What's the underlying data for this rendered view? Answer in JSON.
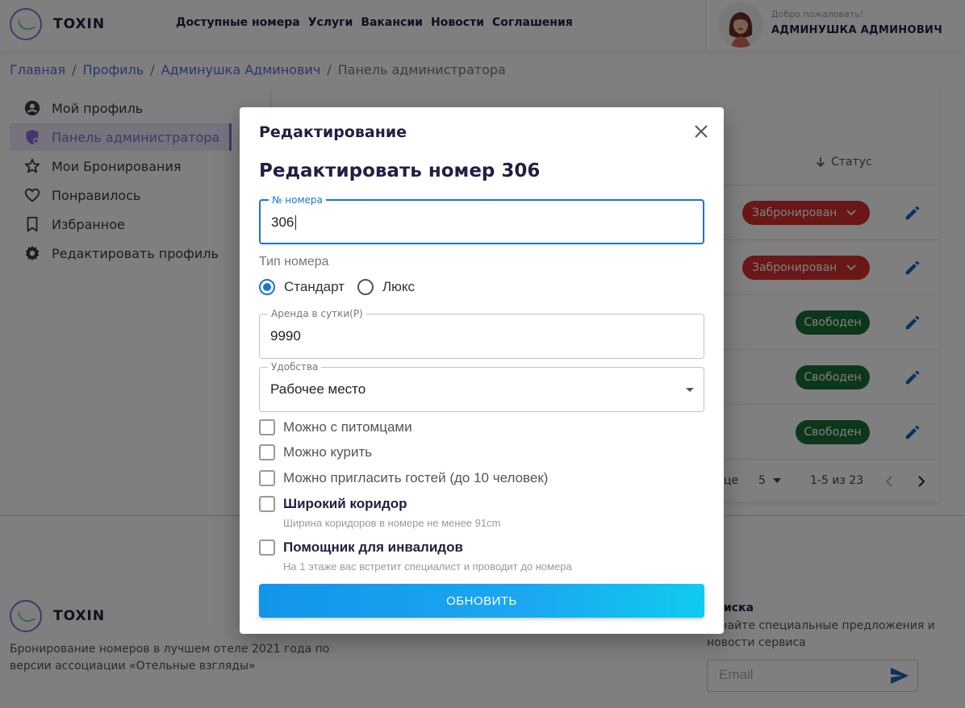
{
  "header": {
    "logo_text": "TOXIN",
    "nav": [
      "Доступные номера",
      "Услуги",
      "Вакансии",
      "Новости",
      "Соглашения"
    ],
    "welcome": "Добро пожаловать!",
    "username": "АДМИНУШКА АДМИНОВИЧ"
  },
  "breadcrumb": {
    "items": [
      "Главная",
      "Профиль",
      "Админушка Админович"
    ],
    "current": "Панель администратора",
    "separator": "/"
  },
  "sidebar": {
    "items": [
      {
        "label": "Мой профиль",
        "icon": "account-circle-icon"
      },
      {
        "label": "Панель администратора",
        "icon": "admin-shield-icon",
        "active": true
      },
      {
        "label": "Мои Бронирования",
        "icon": "star-icon"
      },
      {
        "label": "Понравилось",
        "icon": "heart-icon"
      },
      {
        "label": "Избранное",
        "icon": "bookmark-icon"
      },
      {
        "label": "Редактировать профиль",
        "icon": "gear-icon"
      }
    ]
  },
  "table": {
    "status_header": "Статус",
    "rows": [
      {
        "status": "Забронирован",
        "type": "booked"
      },
      {
        "status": "Забронирован",
        "type": "booked"
      },
      {
        "status": "Свободен",
        "type": "free"
      },
      {
        "status": "Свободен",
        "type": "free"
      },
      {
        "status": "Свободен",
        "type": "free"
      }
    ],
    "pagination": {
      "rows_label_fragment": "це",
      "rows_per_page": "5",
      "range": "1-5 из 23"
    }
  },
  "footer": {
    "logo_text": "TOXIN",
    "description": "Бронирование номеров в лучшем отеле 2021 года по версии ассоциации «Отельные взгляды»",
    "subscribe_title": "дписка",
    "subscribe_desc": "лучайте специальные предложения и новости сервиса",
    "email_placeholder": "Email"
  },
  "modal": {
    "title": "Редактирование",
    "heading": "Редактировать номер 306",
    "room_number": {
      "label": "№ номера",
      "value": "306"
    },
    "room_type": {
      "label": "Тип номера",
      "options": [
        {
          "label": "Стандарт",
          "checked": true
        },
        {
          "label": "Люкс",
          "checked": false
        }
      ]
    },
    "price": {
      "label": "Аренда в сутки(Р)",
      "value": "9990"
    },
    "amenities": {
      "label": "Удобства",
      "value": "Рабочее место"
    },
    "checkboxes": [
      {
        "label": "Можно с питомцами",
        "checked": false
      },
      {
        "label": "Можно курить",
        "checked": false
      },
      {
        "label": "Можно пригласить гостей (до 10 человек)",
        "checked": false
      },
      {
        "label": "Широкий коридор",
        "hint": "Ширина коридоров в номере не менее 91cm",
        "checked": false
      },
      {
        "label": "Помощник для инвалидов",
        "hint": "На 1 этаже вас встретит специалист и проводит до номера",
        "checked": false
      }
    ],
    "submit_label": "ОБНОВИТЬ"
  },
  "colors": {
    "accent_purple": "#8a6bd6",
    "primary_blue": "#1976d2",
    "booked_red": "#d32f2f",
    "free_green": "#1b6e34",
    "button_gradient_start": "#1296ea",
    "button_gradient_end": "#0fcbf0"
  }
}
